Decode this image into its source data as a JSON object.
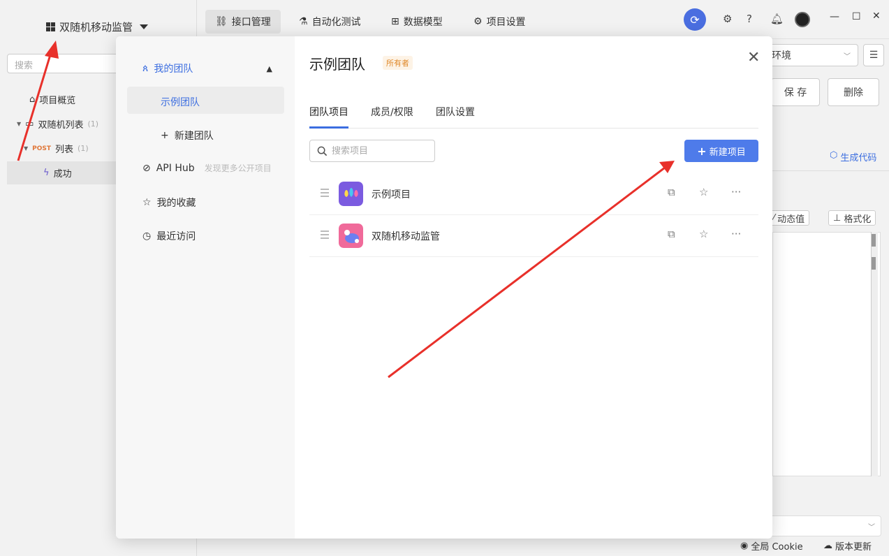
{
  "app": {
    "project_title": "双随机移动监管",
    "search_placeholder": "搜索",
    "tree": [
      {
        "label": "项目概览"
      },
      {
        "label": "双随机列表",
        "count": "(1)"
      },
      {
        "method": "POST",
        "label": "列表",
        "count": "(1)"
      },
      {
        "label": "成功"
      }
    ],
    "top_tabs": [
      "接口管理",
      "自动化测试",
      "数据模型",
      "项目设置"
    ],
    "env_label": "环境",
    "save_label": "保 存",
    "delete_label": "删除",
    "generate_code": "生成代码",
    "dynamic_value": "动态值",
    "format_label": "格式化",
    "global_cookie": "全局 Cookie",
    "version_update": "版本更新"
  },
  "modal": {
    "sidebar": {
      "my_team": "我的团队",
      "example_team": "示例团队",
      "new_team": "新建团队",
      "api_hub": "API Hub",
      "api_hub_hint": "发现更多公开项目",
      "favorites": "我的收藏",
      "recent": "最近访问"
    },
    "title": "示例团队",
    "badge": "所有者",
    "tabs": [
      "团队项目",
      "成员/权限",
      "团队设置"
    ],
    "search_placeholder": "搜索项目",
    "new_project": "新建项目",
    "projects": [
      {
        "name": "示例项目"
      },
      {
        "name": "双随机移动监管"
      }
    ]
  },
  "colors": {
    "accent": "#4e7bea",
    "badge_text": "#e08a2c",
    "arrow": "#e8302a"
  }
}
